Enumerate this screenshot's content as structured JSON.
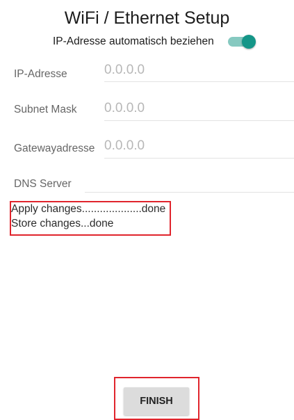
{
  "screen": {
    "title": "WiFi / Ethernet Setup"
  },
  "dhcp": {
    "label": "IP-Adresse automatisch beziehen",
    "enabled": true,
    "accent_color": "#159688",
    "track_color": "#86c9c0"
  },
  "fields": {
    "ip_address": {
      "label": "IP-Adresse",
      "placeholder": "0.0.0.0",
      "value": ""
    },
    "subnet_mask": {
      "label": "Subnet Mask",
      "placeholder": "0.0.0.0",
      "value": ""
    },
    "gateway": {
      "label": "Gatewayadresse",
      "placeholder": "0.0.0.0",
      "value": ""
    },
    "dns_server": {
      "label": "DNS Server",
      "placeholder": "",
      "value": ""
    }
  },
  "status": {
    "lines": [
      "Apply changes....................done",
      "Store changes...done"
    ]
  },
  "actions": {
    "finish_label": "FINISH"
  },
  "highlight_color": "#e0242c"
}
